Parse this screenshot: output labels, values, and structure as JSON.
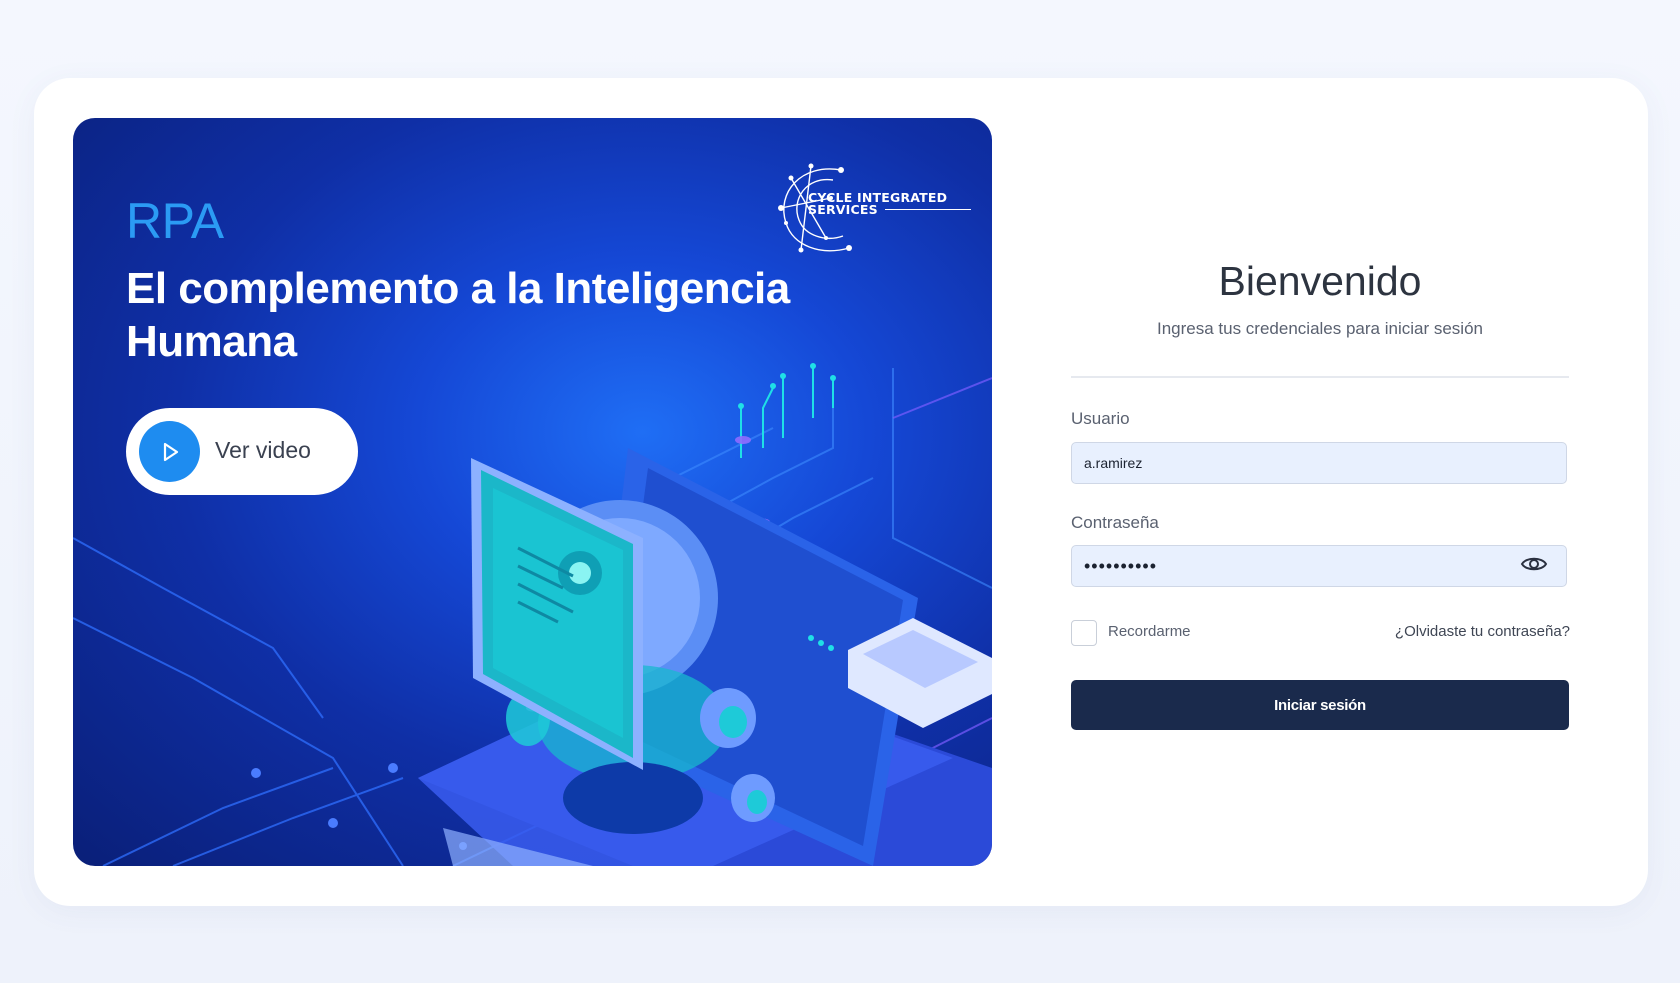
{
  "hero": {
    "eyebrow": "RPA",
    "title": "El complemento a la Inteligencia Humana",
    "video_button_label": "Ver video",
    "logo": {
      "line1": "CYCLE INTEGRATED",
      "line2": "SERVICES"
    }
  },
  "login": {
    "title": "Bienvenido",
    "subtitle": "Ingresa tus credenciales para iniciar sesión",
    "username_label": "Usuario",
    "username_value": "a.ramirez",
    "password_label": "Contraseña",
    "password_value": "••••••••••",
    "remember_label": "Recordarme",
    "remember_checked": false,
    "forgot_link": "¿Olvidaste tu contraseña?",
    "submit_label": "Iniciar sesión"
  },
  "icons": {
    "play": "play-icon",
    "eye": "eye-icon"
  },
  "colors": {
    "page_background": "#f4f7fe",
    "hero_blue": "#1548d6",
    "accent_blue": "#2b9bf4",
    "button_navy": "#1a2a4c",
    "input_fill": "#e8f0fe"
  }
}
